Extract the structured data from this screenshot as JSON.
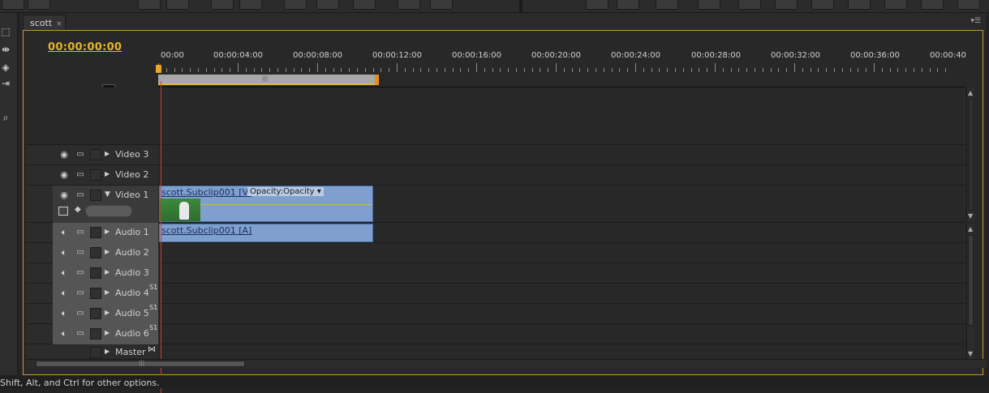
{
  "panel": {
    "tab_label": "scott",
    "tab_close": "×",
    "menu_glyph": "▾☰"
  },
  "timecode": "00:00:00:00",
  "ruler": {
    "labels": [
      "00:00",
      "00:00:04:00",
      "00:00:08:00",
      "00:00:12:00",
      "00:00:16:00",
      "00:00:20:00",
      "00:00:24:00",
      "00:00:28:00",
      "00:00:32:00",
      "00:00:36:00",
      "00:00:40"
    ]
  },
  "tracks": {
    "video": [
      {
        "name": "Video 3"
      },
      {
        "name": "Video 2"
      },
      {
        "name": "Video 1"
      }
    ],
    "audio": [
      {
        "name": "Audio 1",
        "sub": ""
      },
      {
        "name": "Audio 2",
        "sub": ""
      },
      {
        "name": "Audio 3",
        "sub": ""
      },
      {
        "name": "Audio 4",
        "sub": "S1"
      },
      {
        "name": "Audio 5",
        "sub": "S1"
      },
      {
        "name": "Audio 6",
        "sub": "S1"
      },
      {
        "name": "Master",
        "sub": ""
      }
    ]
  },
  "clips": {
    "video_name": "scott.Subclip001 [V]",
    "video_opacity": "Opacity:Opacity ▾",
    "audio_name": "scott.Subclip001 [A]"
  },
  "status_text": "Shift, Alt, and Ctrl for other options.",
  "icons": {
    "snap": "snap-icon",
    "marker": "marker-icon",
    "eye": "eye-icon",
    "speaker": "speaker-icon",
    "filmstrip": "filmstrip-icon"
  },
  "colors": {
    "timecode": "#e4b32c",
    "clip": "#7fa0cf",
    "playhead": "#cf3c2c",
    "frame_border": "#c69a2c"
  }
}
